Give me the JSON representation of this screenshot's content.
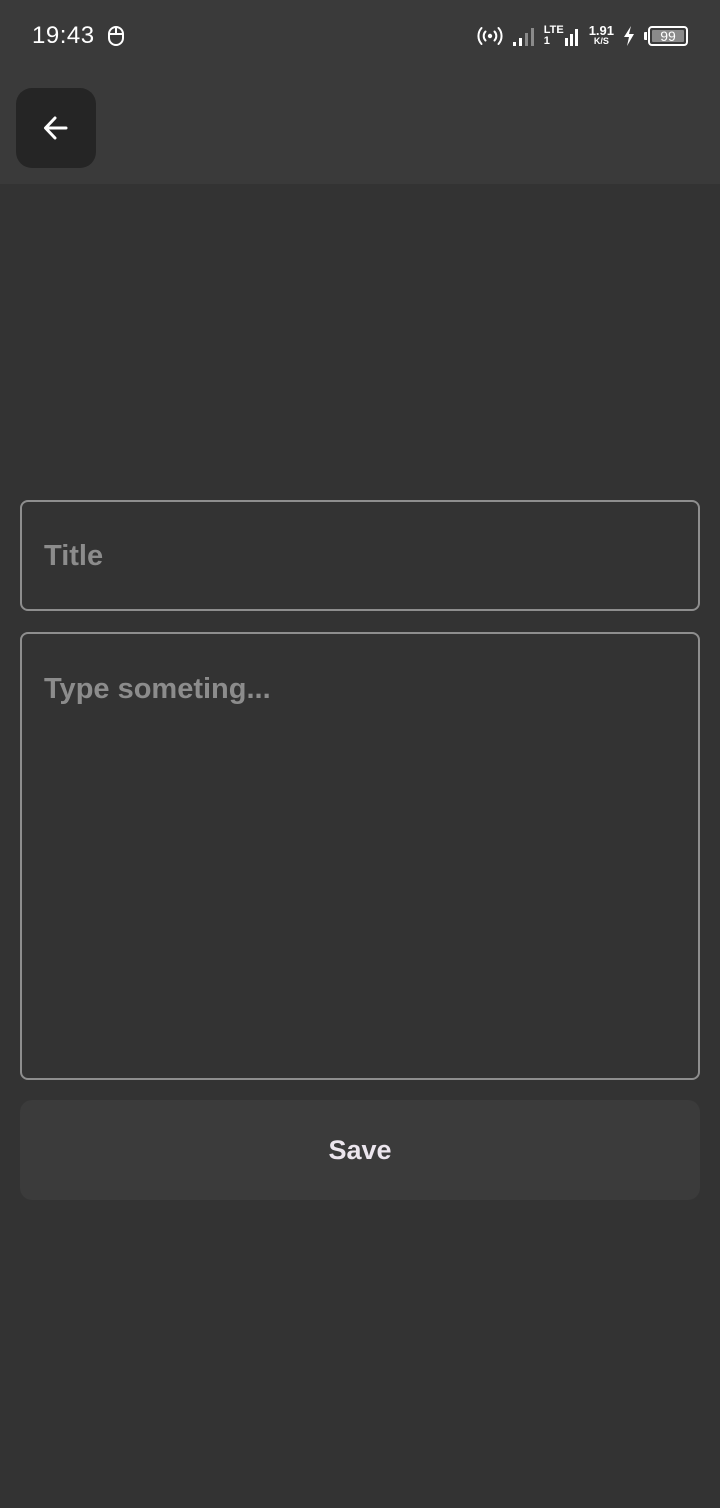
{
  "status_bar": {
    "time": "19:43",
    "network_label_top": "LTE",
    "network_label_bottom": "1",
    "speed_value": "1.91",
    "speed_unit": "K/S",
    "battery_level": "99",
    "battery_fraction": 0.99
  },
  "icons": {
    "notification": "mouse-icon",
    "hotspot": "hotspot-icon",
    "signal": "signal-icon",
    "charging": "charging-icon",
    "back": "arrow-left-icon"
  },
  "form": {
    "title_placeholder": "Title",
    "title_value": "",
    "body_placeholder": "Type someting...",
    "body_value": "",
    "save_label": "Save"
  },
  "colors": {
    "background": "#333333",
    "header": "#3a3a3a",
    "back_button": "#252525",
    "field_border": "#8e8e8e",
    "placeholder": "#8c8c8c",
    "save_button": "#3b3b3b",
    "save_text": "#ece6ee"
  }
}
